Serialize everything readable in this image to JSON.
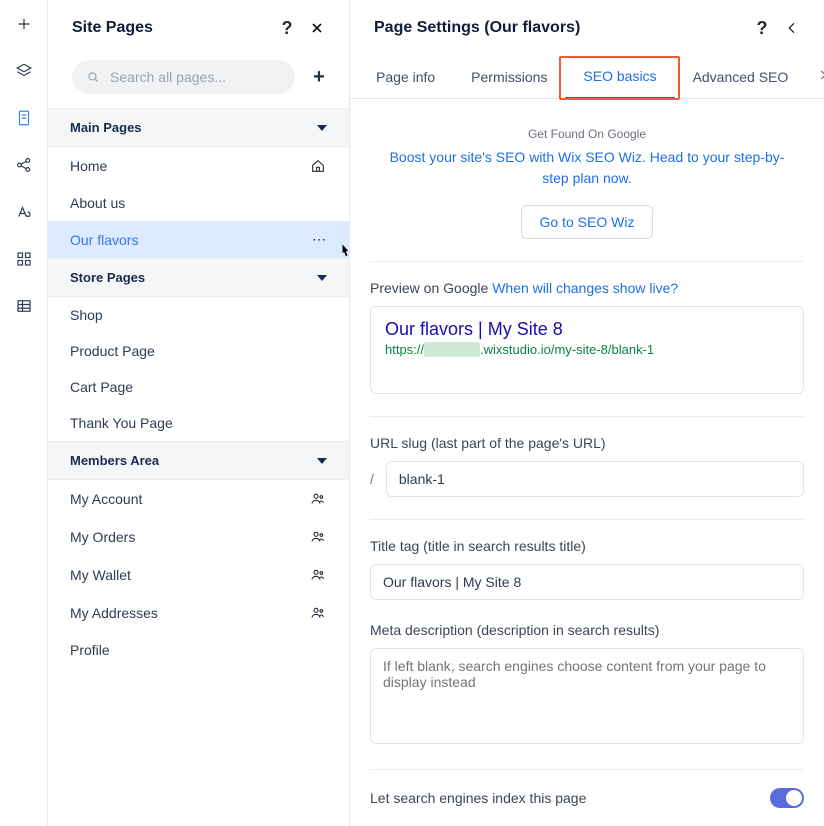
{
  "rail": {
    "items": [
      {
        "name": "add-icon"
      },
      {
        "name": "layers-icon"
      },
      {
        "name": "page-icon",
        "active": true
      },
      {
        "name": "share-icon"
      },
      {
        "name": "text-style-icon"
      },
      {
        "name": "apps-grid-icon"
      },
      {
        "name": "database-icon"
      }
    ]
  },
  "pages": {
    "title": "Site Pages",
    "search_placeholder": "Search all pages...",
    "sections": [
      {
        "label": "Main Pages",
        "items": [
          {
            "label": "Home",
            "icon": "home-icon"
          },
          {
            "label": "About us"
          },
          {
            "label": "Our flavors",
            "selected": true,
            "icon": "more-dots-icon"
          }
        ]
      },
      {
        "label": "Store Pages",
        "items": [
          {
            "label": "Shop"
          },
          {
            "label": "Product Page"
          },
          {
            "label": "Cart Page"
          },
          {
            "label": "Thank You Page"
          }
        ]
      },
      {
        "label": "Members Area",
        "items": [
          {
            "label": "My Account",
            "icon": "members-icon"
          },
          {
            "label": "My Orders",
            "icon": "members-icon"
          },
          {
            "label": "My Wallet",
            "icon": "members-icon"
          },
          {
            "label": "My Addresses",
            "icon": "members-icon"
          },
          {
            "label": "Profile"
          }
        ]
      }
    ]
  },
  "settings": {
    "title": "Page Settings (Our flavors)",
    "tabs": [
      {
        "label": "Page info"
      },
      {
        "label": "Permissions"
      },
      {
        "label": "SEO basics",
        "active": true,
        "highlight": true
      },
      {
        "label": "Advanced SEO"
      }
    ],
    "intro_small": "Get Found On Google",
    "intro_text": "Boost your site's SEO with Wix SEO Wiz. Head to your step-by-step plan now.",
    "wiz_button": "Go to SEO Wiz",
    "preview_label": "Preview on Google",
    "preview_link": "When will changes show live?",
    "preview_title": "Our flavors | My Site 8",
    "preview_url_prefix": "https://",
    "preview_url_blur": "xxxxxxxx",
    "preview_url_suffix": ".wixstudio.io/my-site-8/blank-1",
    "url_slug_label": "URL slug (last part of the page's URL)",
    "url_slug_value": "blank-1",
    "title_tag_label": "Title tag (title in search results title)",
    "title_tag_value": "Our flavors | My Site 8",
    "meta_label": "Meta description (description in search results)",
    "meta_placeholder": "If left blank, search engines choose content from your page to display instead",
    "index_label": "Let search engines index this page",
    "index_on": true
  }
}
